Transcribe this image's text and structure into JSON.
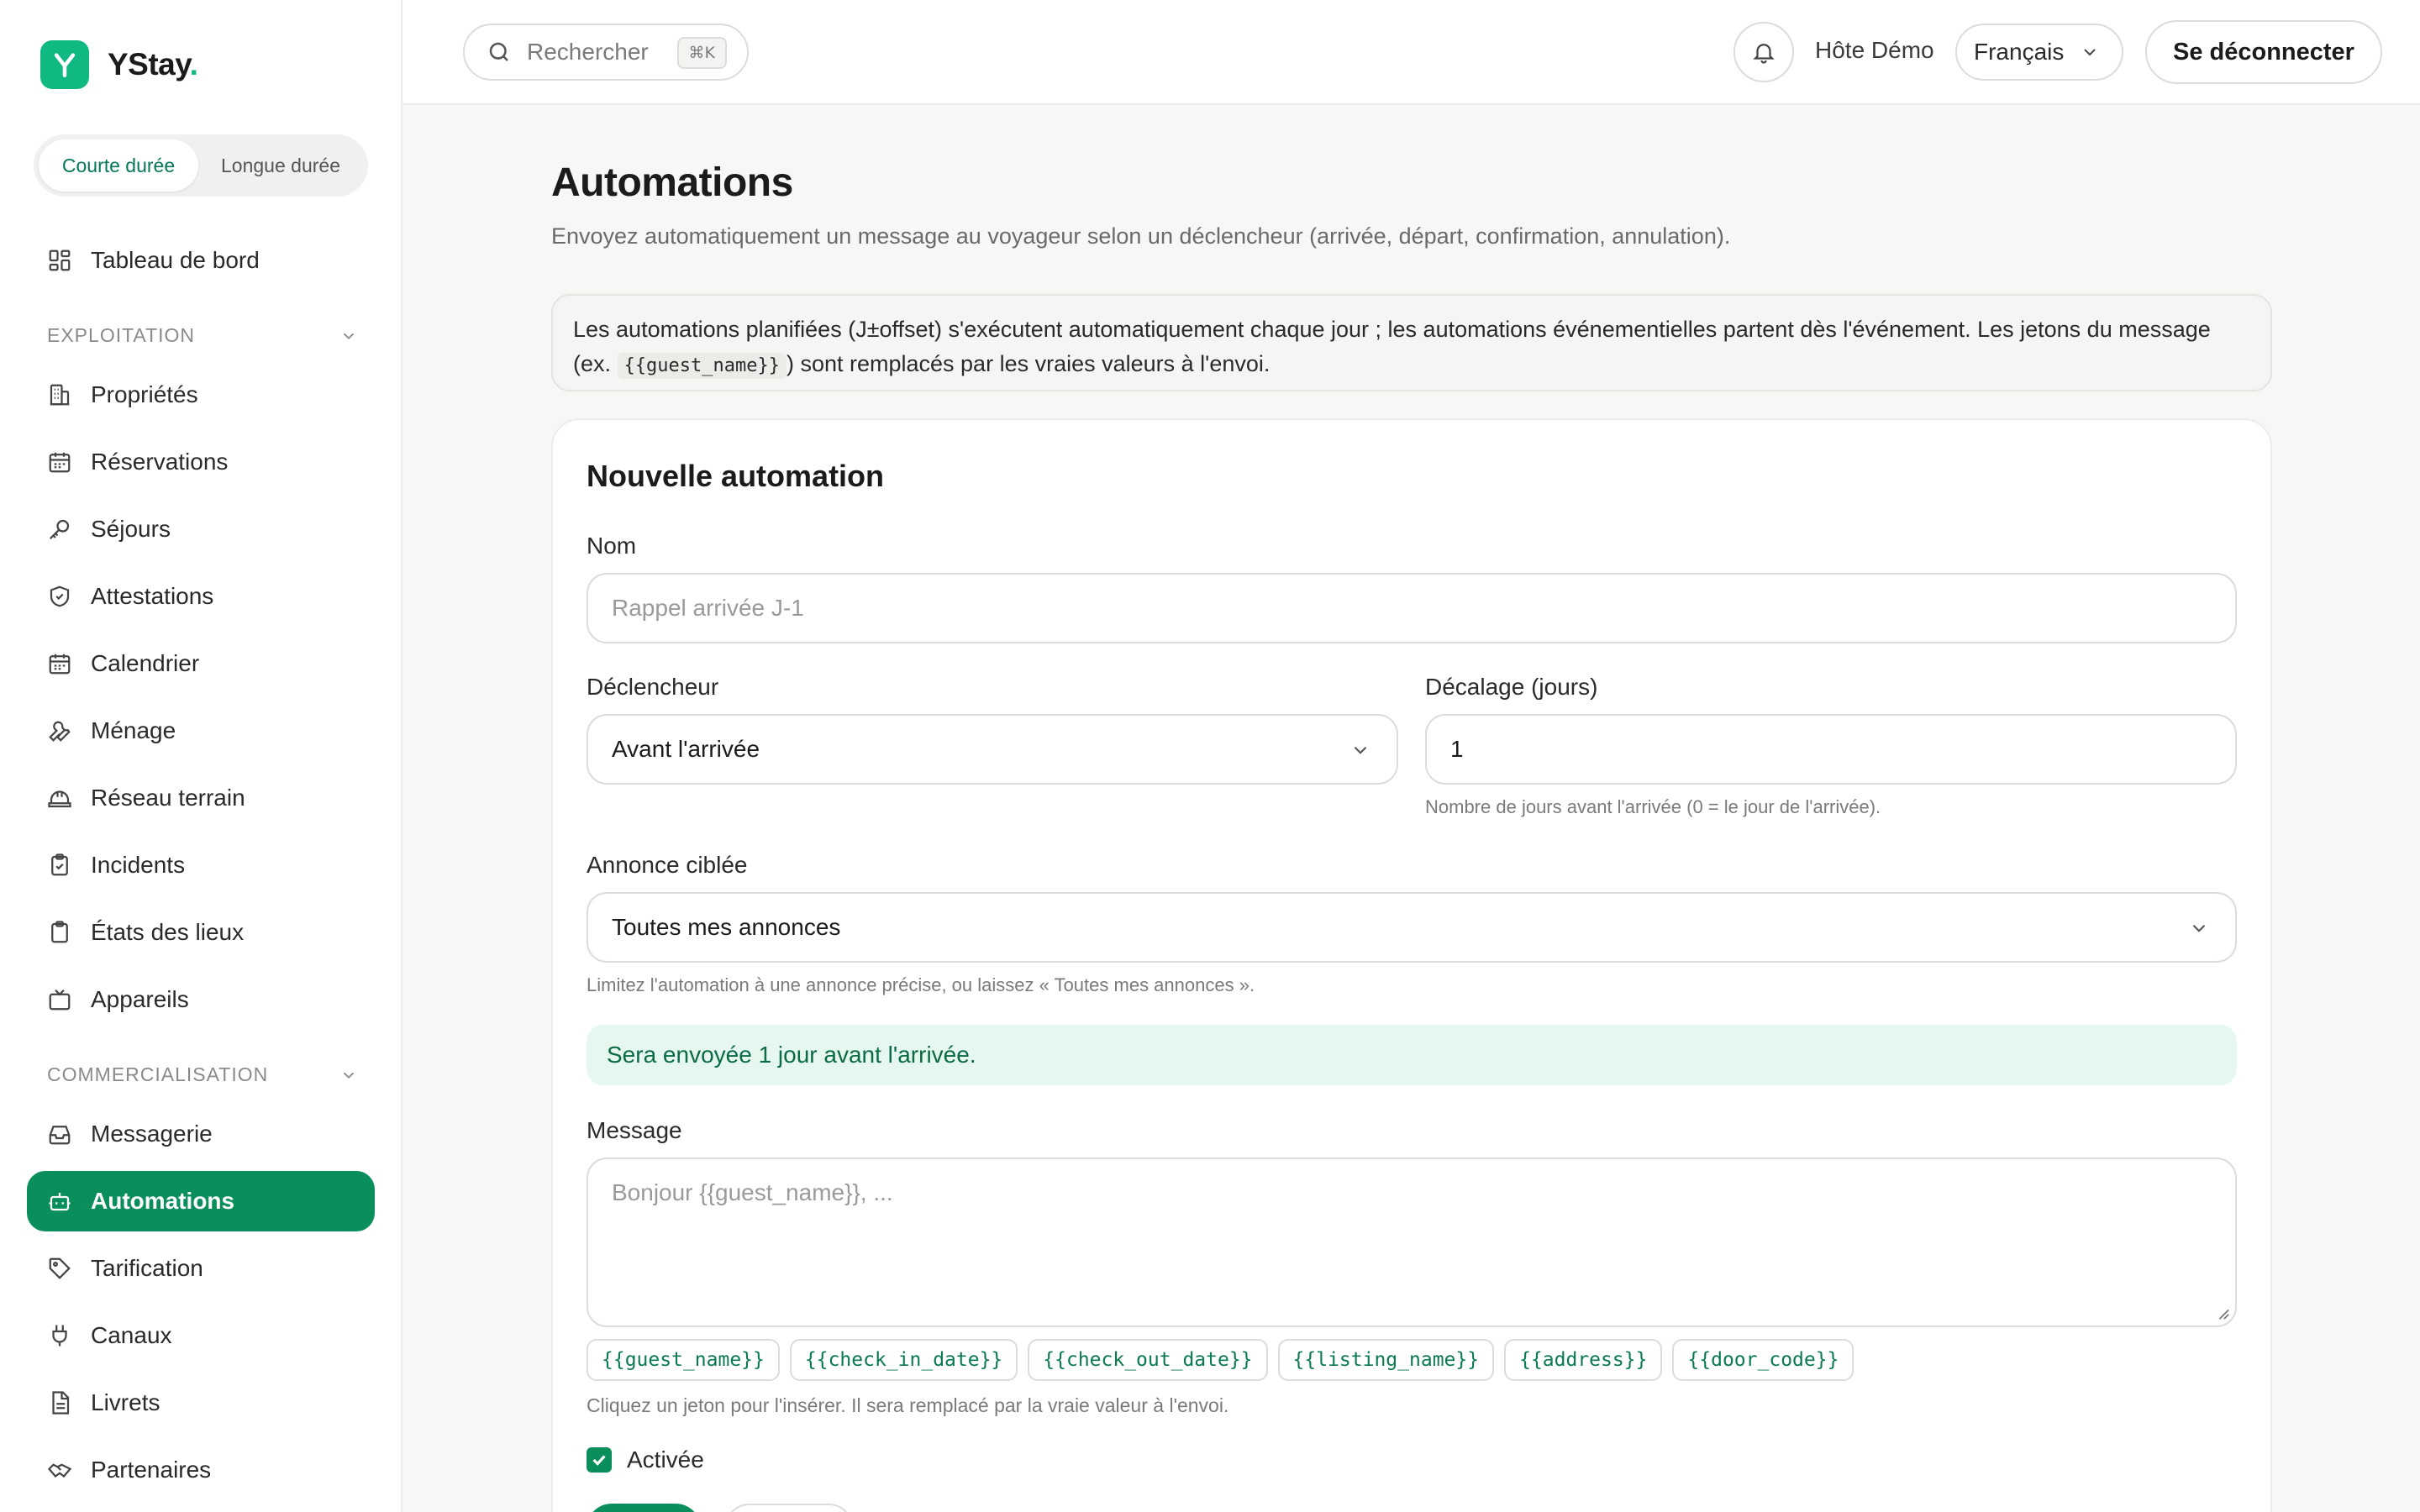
{
  "brand": {
    "name": "YStay",
    "accent": "#10b981"
  },
  "segmented": {
    "short": "Courte durée",
    "long": "Longue durée"
  },
  "nav": {
    "dashboard": "Tableau de bord",
    "section_exploitation": "EXPLOITATION",
    "exploitation": [
      "Propriétés",
      "Réservations",
      "Séjours",
      "Attestations",
      "Calendrier",
      "Ménage",
      "Réseau terrain",
      "Incidents",
      "États des lieux",
      "Appareils"
    ],
    "section_commercial": "COMMERCIALISATION",
    "commercial": [
      "Messagerie",
      "Automations",
      "Tarification",
      "Canaux",
      "Livrets",
      "Partenaires"
    ],
    "active": "Automations",
    "active_color": "#0a8f5c"
  },
  "topbar": {
    "search_placeholder": "Rechercher",
    "search_shortcut": "⌘K",
    "host": "Hôte Démo",
    "language": "Français",
    "logout": "Se déconnecter"
  },
  "page": {
    "title": "Automations",
    "subtitle": "Envoyez automatiquement un message au voyageur selon un déclencheur (arrivée, départ, confirmation, annulation).",
    "info_before": "Les automations planifiées (J±offset) s'exécutent automatiquement chaque jour ; les automations événementielles partent dès l'événement. Les jetons du message (ex.",
    "info_code": "{{guest_name}}",
    "info_after": ") sont remplacés par les vraies valeurs à l'envoi."
  },
  "form": {
    "title": "Nouvelle automation",
    "name_label": "Nom",
    "name_placeholder": "Rappel arrivée J-1",
    "trigger_label": "Déclencheur",
    "trigger_value": "Avant l'arrivée",
    "offset_label": "Décalage (jours)",
    "offset_value": "1",
    "offset_hint": "Nombre de jours avant l'arrivée (0 = le jour de l'arrivée).",
    "listing_label": "Annonce ciblée",
    "listing_value": "Toutes mes annonces",
    "listing_hint": "Limitez l'automation à une annonce précise, ou laissez « Toutes mes annonces ».",
    "notice": "Sera envoyée 1 jour avant l'arrivée.",
    "message_label": "Message",
    "message_placeholder": "Bonjour {{guest_name}}, ...",
    "tokens": [
      "{{guest_name}}",
      "{{check_in_date}}",
      "{{check_out_date}}",
      "{{listing_name}}",
      "{{address}}",
      "{{door_code}}"
    ],
    "tokens_hint": "Cliquez un jeton pour l'insérer. Il sera remplacé par la vraie valeur à l'envoi.",
    "enabled_label": "Activée",
    "enabled": true
  }
}
